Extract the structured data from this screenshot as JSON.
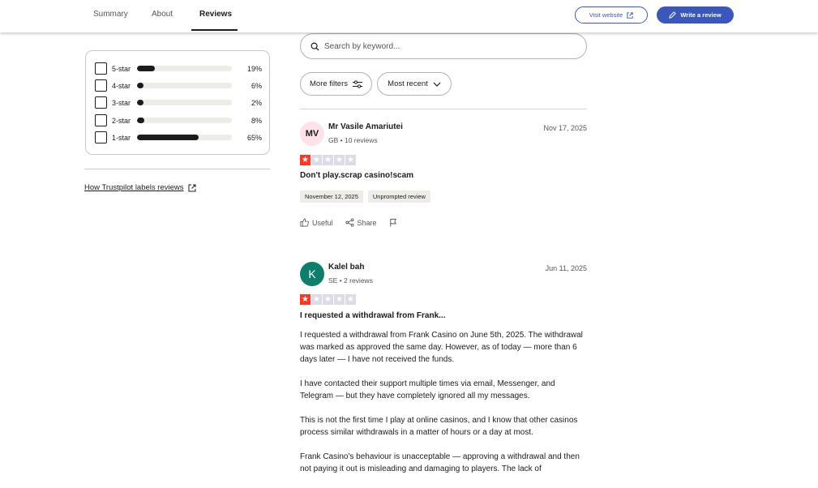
{
  "nav": {
    "tabs": [
      {
        "label": "Summary"
      },
      {
        "label": "About"
      },
      {
        "label": "Reviews"
      }
    ],
    "visit_label": "Visit website",
    "write_label": "Write a review",
    "accent": "#3c57bc"
  },
  "filters": {
    "ratings": [
      {
        "label": "5-star",
        "percent": "19%",
        "fraction": 0.19
      },
      {
        "label": "4-star",
        "percent": "6%",
        "fraction": 0.06
      },
      {
        "label": "3-star",
        "percent": "2%",
        "fraction": 0.02
      },
      {
        "label": "2-star",
        "percent": "8%",
        "fraction": 0.08
      },
      {
        "label": "1-star",
        "percent": "65%",
        "fraction": 0.65
      }
    ],
    "labels_link": "How Trustpilot labels reviews"
  },
  "search": {
    "placeholder": "Search by keyword..."
  },
  "toolbar": {
    "more_filters": "More filters",
    "sort": "Most recent"
  },
  "reviews": [
    {
      "initials": "MV",
      "name": "Mr Vasile Amariutei",
      "meta": "GB • 10 reviews",
      "date": "Nov 17, 2025",
      "stars": 1,
      "title": "Don't play.scrap casino!scam",
      "tags": [
        "November 12, 2025",
        "Unprompted review"
      ],
      "useful": "Useful",
      "share": "Share"
    },
    {
      "initials": "K",
      "name": "Kalel bah",
      "meta": "SE • 2 reviews",
      "date": "Jun 11, 2025",
      "stars": 1,
      "title": "I requested a withdrawal from Frank...",
      "body": [
        "I requested a withdrawal from Frank Casino on June 5th, 2025. The withdrawal was marked as approved the same day. However, as of today — more than 6 days later — I have not received the funds.",
        "I have contacted their support multiple times via email, Messenger, and Telegram — but they have completely ignored all my messages.",
        "This is not the first time I play at online casinos, and I know that other casinos process similar withdrawals in a matter of hours or a day at most.",
        "Frank Casino's behaviour is unacceptable — approving a withdrawal and then not paying it out is misleading and damaging to players. The lack of"
      ]
    }
  ]
}
